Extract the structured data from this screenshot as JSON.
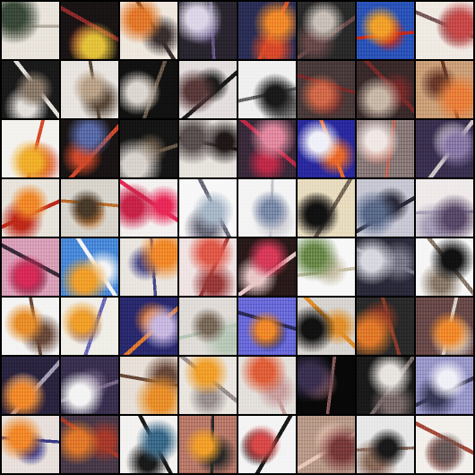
{
  "grid": {
    "rows": 8,
    "cols": 8,
    "tiles": [
      {
        "base": "#e9e4dc",
        "a": "#3a4a3a",
        "b": "#b9b0a4"
      },
      {
        "base": "#1a1414",
        "a": "#e3c23a",
        "b": "#8e2a2a"
      },
      {
        "base": "#efe8df",
        "a": "#e27a2a",
        "b": "#3a3030"
      },
      {
        "base": "#2a2630",
        "a": "#dcd6e8",
        "b": "#6a5a8a"
      },
      {
        "base": "#2b2f55",
        "a": "#f08a2a",
        "b": "#d84a2a"
      },
      {
        "base": "#2a2a2a",
        "a": "#c8c0b8",
        "b": "#6a4a4a"
      },
      {
        "base": "#2b54b8",
        "a": "#f0a22a",
        "b": "#c82a1a"
      },
      {
        "base": "#f0eae4",
        "a": "#c84a4a",
        "b": "#7a5a5a"
      },
      {
        "base": "#1a1a1a",
        "a": "#8a7a6a",
        "b": "#e4e0dc"
      },
      {
        "base": "#e8e4e0",
        "a": "#b9a28a",
        "b": "#5a4a3a"
      },
      {
        "base": "#111",
        "a": "#dcd6d0",
        "b": "#6a5a4a"
      },
      {
        "base": "#e4dede",
        "a": "#5a3a3a",
        "b": "#1a1a1a"
      },
      {
        "base": "#f0f0f0",
        "a": "#1a1a1a",
        "b": "#6a6a6a"
      },
      {
        "base": "#4a3a3a",
        "a": "#d06a4a",
        "b": "#7a2a2a"
      },
      {
        "base": "#3a2a2a",
        "a": "#c8b8a8",
        "b": "#7a2a2a"
      },
      {
        "base": "#caa07a",
        "a": "#e8803a",
        "b": "#6a3a2a"
      },
      {
        "base": "#f4f2ee",
        "a": "#f0b02a",
        "b": "#d84a2a"
      },
      {
        "base": "#1a1414",
        "a": "#5a6aa8",
        "b": "#d04a2a"
      },
      {
        "base": "#151515",
        "a": "#d8d2cc",
        "b": "#6a5a4a"
      },
      {
        "base": "#e8e4de",
        "a": "#5a5050",
        "b": "#201818"
      },
      {
        "base": "#3a2a3a",
        "a": "#e08aa0",
        "b": "#c02a4a"
      },
      {
        "base": "#2a2aa0",
        "a": "#f0f0f8",
        "b": "#e86a2a"
      },
      {
        "base": "#8a7a7a",
        "a": "#f0e8e4",
        "b": "#c06a5a"
      },
      {
        "base": "#3a3050",
        "a": "#8a7aa8",
        "b": "#d0c8c8"
      },
      {
        "base": "#e8e4dc",
        "a": "#f08a2a",
        "b": "#c02a1a"
      },
      {
        "base": "#d8d4cc",
        "a": "#4a3a2a",
        "b": "#c0702a"
      },
      {
        "base": "#f4f0f0",
        "a": "#c8244a",
        "b": "#e82a5a"
      },
      {
        "base": "#f8f8f8",
        "a": "#a8b8c8",
        "b": "#6a6a7a"
      },
      {
        "base": "#f4f4f4",
        "a": "#7a8aa8",
        "b": "#c8c8d0"
      },
      {
        "base": "#e8dcc0",
        "a": "#111",
        "b": "#7a6a5a"
      },
      {
        "base": "#c8c8d4",
        "a": "#5a6a8a",
        "b": "#2a2a3a"
      },
      {
        "base": "#f0eaea",
        "a": "#5a4a6a",
        "b": "#a8a0b8"
      },
      {
        "base": "#d8a0b8",
        "a": "#d82a5a",
        "b": "#3a2a3a"
      },
      {
        "base": "#4a8ad8",
        "a": "#f0a02a",
        "b": "#f4f4f4"
      },
      {
        "base": "#eae6e0",
        "a": "#f08a2a",
        "b": "#4a4a8a"
      },
      {
        "base": "#f0e4e4",
        "a": "#e05a4a",
        "b": "#9a3a3a"
      },
      {
        "base": "#2a1a1a",
        "a": "#d83a5a",
        "b": "#e8c8c8"
      },
      {
        "base": "#f8f8f8",
        "a": "#6a8a4a",
        "b": "#c8c0a8"
      },
      {
        "base": "#2a2a3a",
        "a": "#d8d8e0",
        "b": "#7a7a8a"
      },
      {
        "base": "#f6f6f6",
        "a": "#111",
        "b": "#8a7a6a"
      },
      {
        "base": "#f4f4f4",
        "a": "#e8902a",
        "b": "#6a4a3a"
      },
      {
        "base": "#f0eee8",
        "a": "#f0a02a",
        "b": "#6a6ab8"
      },
      {
        "base": "#2a2a70",
        "a": "#c8b8e0",
        "b": "#e07a2a"
      },
      {
        "base": "#e0dcd8",
        "a": "#7a6a5a",
        "b": "#b8c8b8"
      },
      {
        "base": "#6a6ad8",
        "a": "#f08a2a",
        "b": "#2a2a5a"
      },
      {
        "base": "#d8d4d0",
        "a": "#111",
        "b": "#e0902a"
      },
      {
        "base": "#2a2a2a",
        "a": "#e07a2a",
        "b": "#8a3a2a"
      },
      {
        "base": "#6a4a4a",
        "a": "#f08a2a",
        "b": "#d8d0c8"
      },
      {
        "base": "#2a2440",
        "a": "#f08a2a",
        "b": "#a8a0b8"
      },
      {
        "base": "#3a3050",
        "a": "#f4f4f4",
        "b": "#7a6a8a"
      },
      {
        "base": "#e8e0d8",
        "a": "#e8902a",
        "b": "#6a4a3a"
      },
      {
        "base": "#eae6e0",
        "a": "#f0a02a",
        "b": "#9a9090"
      },
      {
        "base": "#e4e0dc",
        "a": "#e0603a",
        "b": "#c8a0a0"
      },
      {
        "base": "#080808",
        "a": "#3a3050",
        "b": "#8a5a5a"
      },
      {
        "base": "#1a1a1a",
        "a": "#e8e4e0",
        "b": "#7a6a6a"
      },
      {
        "base": "#9a98c8",
        "a": "#f0f0f8",
        "b": "#3a3a5a"
      },
      {
        "base": "#e8e0dc",
        "a": "#f08a2a",
        "b": "#3a3a8a"
      },
      {
        "base": "#4a3a4a",
        "a": "#e07a2a",
        "b": "#a83a2a"
      },
      {
        "base": "#f4f2f0",
        "a": "#3a6a8a",
        "b": "#1a1a1a"
      },
      {
        "base": "#b87a6a",
        "a": "#f0a02a",
        "b": "#2a2a2a"
      },
      {
        "base": "#f4f4f4",
        "a": "#d84a4a",
        "b": "#1a1a1a"
      },
      {
        "base": "#b89a8a",
        "a": "#7a3a3a",
        "b": "#e8c8b8"
      },
      {
        "base": "#e8e8e8",
        "a": "#1a1a1a",
        "b": "#8a6a5a"
      },
      {
        "base": "#f4f0ec",
        "a": "#6a5a5a",
        "b": "#a84a3a"
      }
    ]
  }
}
